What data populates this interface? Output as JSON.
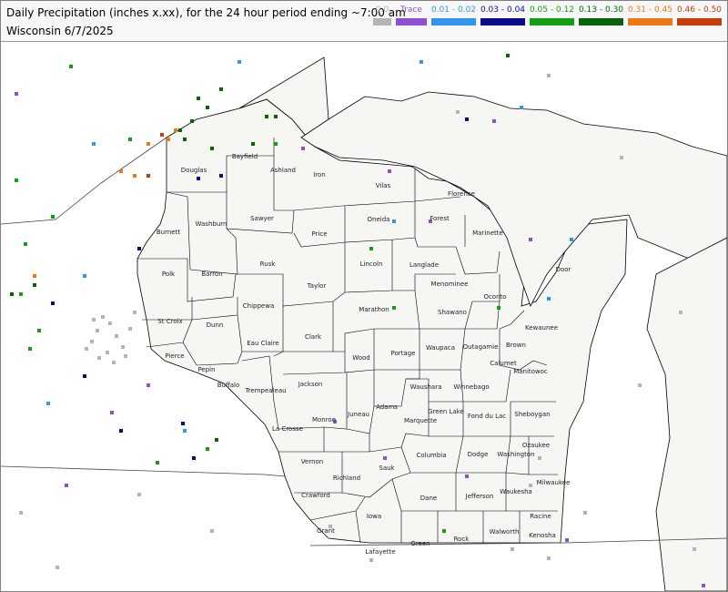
{
  "header": {
    "title": "Daily Precipitation (inches  x.xx),  for the 24 hour period ending ~7:00 am",
    "subtitle": "Wisconsin 6/7/2025"
  },
  "legend": [
    {
      "label": "0.0",
      "color": "#b4b4b4",
      "text_color": "#b4b4b4"
    },
    {
      "label": "Trace",
      "color": "#8c50d2",
      "text_color": "#8c50d2"
    },
    {
      "label": "0.01 - 0.02",
      "color": "#3296f0",
      "text_color": "#3296f0"
    },
    {
      "label": "0.03 - 0.04",
      "color": "#0a0a8c",
      "text_color": "#0a0a8c"
    },
    {
      "label": "0.05 - 0.12",
      "color": "#14a014",
      "text_color": "#14a014"
    },
    {
      "label": "0.13 - 0.30",
      "color": "#0a640a",
      "text_color": "#0a640a"
    },
    {
      "label": "0.31 - 0.45",
      "color": "#f07814",
      "text_color": "#f07814"
    },
    {
      "label": "0.46 - 0.50",
      "color": "#c83c0a",
      "text_color": "#c83c0a"
    }
  ],
  "counties": [
    "Douglas",
    "Bayfield",
    "Ashland",
    "Iron",
    "Vilas",
    "Florence",
    "Forest",
    "Oneida",
    "Marinette",
    "Price",
    "Sawyer",
    "Washburn",
    "Burnett",
    "Polk",
    "Barron",
    "Rusk",
    "Lincoln",
    "Langlade",
    "Taylor",
    "Menominee",
    "Oconto",
    "Marathon",
    "Shawano",
    "Chippewa",
    "St Croix",
    "Dunn",
    "Eau Claire",
    "Clark",
    "Kewaunee",
    "Door",
    "Brown",
    "Wood",
    "Portage",
    "Waupaca",
    "Outagamie",
    "Pierce",
    "Pepin",
    "Buffalo",
    "Trempealeau",
    "Jackson",
    "Manitowoc",
    "Calumet",
    "Waushara",
    "Winnebago",
    "Sheboygan",
    "Juneau",
    "Adams",
    "Green Lake",
    "Fond du Lac",
    "La Crosse",
    "Monroe",
    "Marquette",
    "Ozaukee",
    "Columbia",
    "Dodge",
    "Washington",
    "Vernon",
    "Richland",
    "Sauk",
    "Milwaukee",
    "Waukesha",
    "Crawford",
    "Dane",
    "Jefferson",
    "Racine",
    "Iowa",
    "Grant",
    "Walworth",
    "Kenosha",
    "Lafayette",
    "Green",
    "Rock"
  ]
}
